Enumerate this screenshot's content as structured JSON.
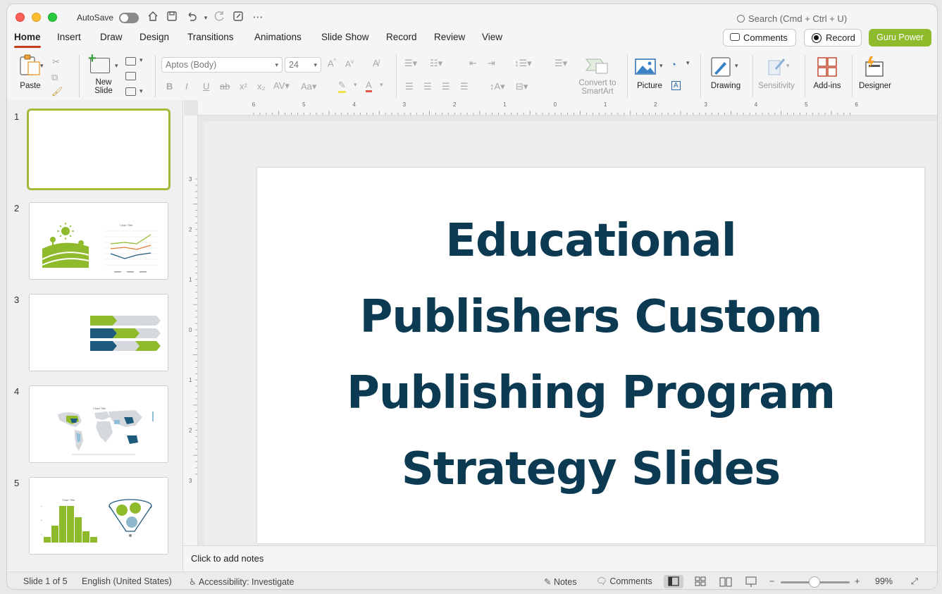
{
  "window": {
    "autosave_label": "AutoSave",
    "search_placeholder": "Search (Cmd + Ctrl + U)"
  },
  "tabs": [
    {
      "label": "Home",
      "active": true
    },
    {
      "label": "Insert"
    },
    {
      "label": "Draw"
    },
    {
      "label": "Design"
    },
    {
      "label": "Transitions"
    },
    {
      "label": "Animations"
    },
    {
      "label": "Slide Show"
    },
    {
      "label": "Record"
    },
    {
      "label": "Review"
    },
    {
      "label": "View"
    }
  ],
  "header_buttons": {
    "comments": "Comments",
    "record": "Record",
    "guru": "Guru Power"
  },
  "ribbon": {
    "paste": "Paste",
    "new_slide_line1": "New",
    "new_slide_line2": "Slide",
    "font_name": "Aptos (Body)",
    "font_size": "24",
    "convert_smartart_line1": "Convert to",
    "convert_smartart_line2": "SmartArt",
    "picture": "Picture",
    "drawing": "Drawing",
    "sensitivity": "Sensitivity",
    "addins": "Add-ins",
    "designer": "Designer"
  },
  "slides": {
    "numbers": [
      "1",
      "2",
      "3",
      "4",
      "5"
    ],
    "thumb2_chart_title": "Chart Title",
    "thumb4_chart_title": "Chart Title",
    "thumb5_chart_title": "Chart Title"
  },
  "main_slide": {
    "title": "Educational Publishers Custom Publishing Program Strategy Slides"
  },
  "notes_placeholder": "Click to add notes",
  "statusbar": {
    "slide_count": "Slide 1 of 5",
    "language": "English (United States)",
    "accessibility": "Accessibility: Investigate",
    "notes": "Notes",
    "comments": "Comments",
    "zoom": "99%"
  },
  "ruler": {
    "h_labels": [
      "6",
      "5",
      "4",
      "3",
      "2",
      "1",
      "0",
      "1",
      "2",
      "3",
      "4",
      "5",
      "6"
    ],
    "v_labels": [
      "3",
      "2",
      "1",
      "0",
      "1",
      "2",
      "3"
    ]
  },
  "colors": {
    "title": "#0b3a52",
    "accent_green": "#8fba2c",
    "tab_underline": "#c43e1c",
    "thumb_navy": "#1e5a7e",
    "thumb_gray": "#d5d9de"
  }
}
